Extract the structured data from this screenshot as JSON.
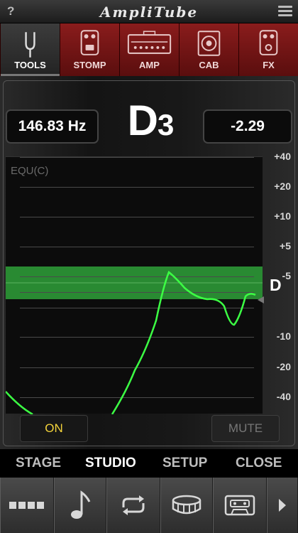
{
  "header": {
    "help_label": "?",
    "logo_text": "AmpliTube"
  },
  "tabs": [
    {
      "label": "TOOLS",
      "icon": "tuning-fork-icon",
      "active": true
    },
    {
      "label": "STOMP",
      "icon": "stompbox-icon",
      "active": false
    },
    {
      "label": "AMP",
      "icon": "amp-head-icon",
      "active": false
    },
    {
      "label": "CAB",
      "icon": "cabinet-icon",
      "active": false
    },
    {
      "label": "FX",
      "icon": "fx-pedal-icon",
      "active": false
    }
  ],
  "tuner": {
    "frequency": "146.83 Hz",
    "note": "D",
    "octave": "3",
    "cents": "-2.29",
    "temperament": "EQU(C)",
    "target_note": "D",
    "scale_labels": [
      "+40",
      "+20",
      "+10",
      "+5",
      "-5",
      "-10",
      "-20",
      "-40"
    ],
    "on_label": "ON",
    "mute_label": "MUTE",
    "on_active": true,
    "mute_active": false,
    "accent_color": "#f3d33b",
    "band_color": "#2fa13a",
    "trace_color": "#3cff44"
  },
  "nav": {
    "items": [
      {
        "label": "STAGE",
        "active": false
      },
      {
        "label": "STUDIO",
        "active": true
      },
      {
        "label": "SETUP",
        "active": false
      },
      {
        "label": "CLOSE",
        "active": false
      }
    ]
  },
  "toolbar": {
    "buttons": [
      {
        "icon": "track-blocks-icon"
      },
      {
        "icon": "music-note-icon"
      },
      {
        "icon": "loop-icon"
      },
      {
        "icon": "drum-icon"
      },
      {
        "icon": "cassette-icon"
      },
      {
        "icon": "play-arrow-icon"
      }
    ]
  }
}
